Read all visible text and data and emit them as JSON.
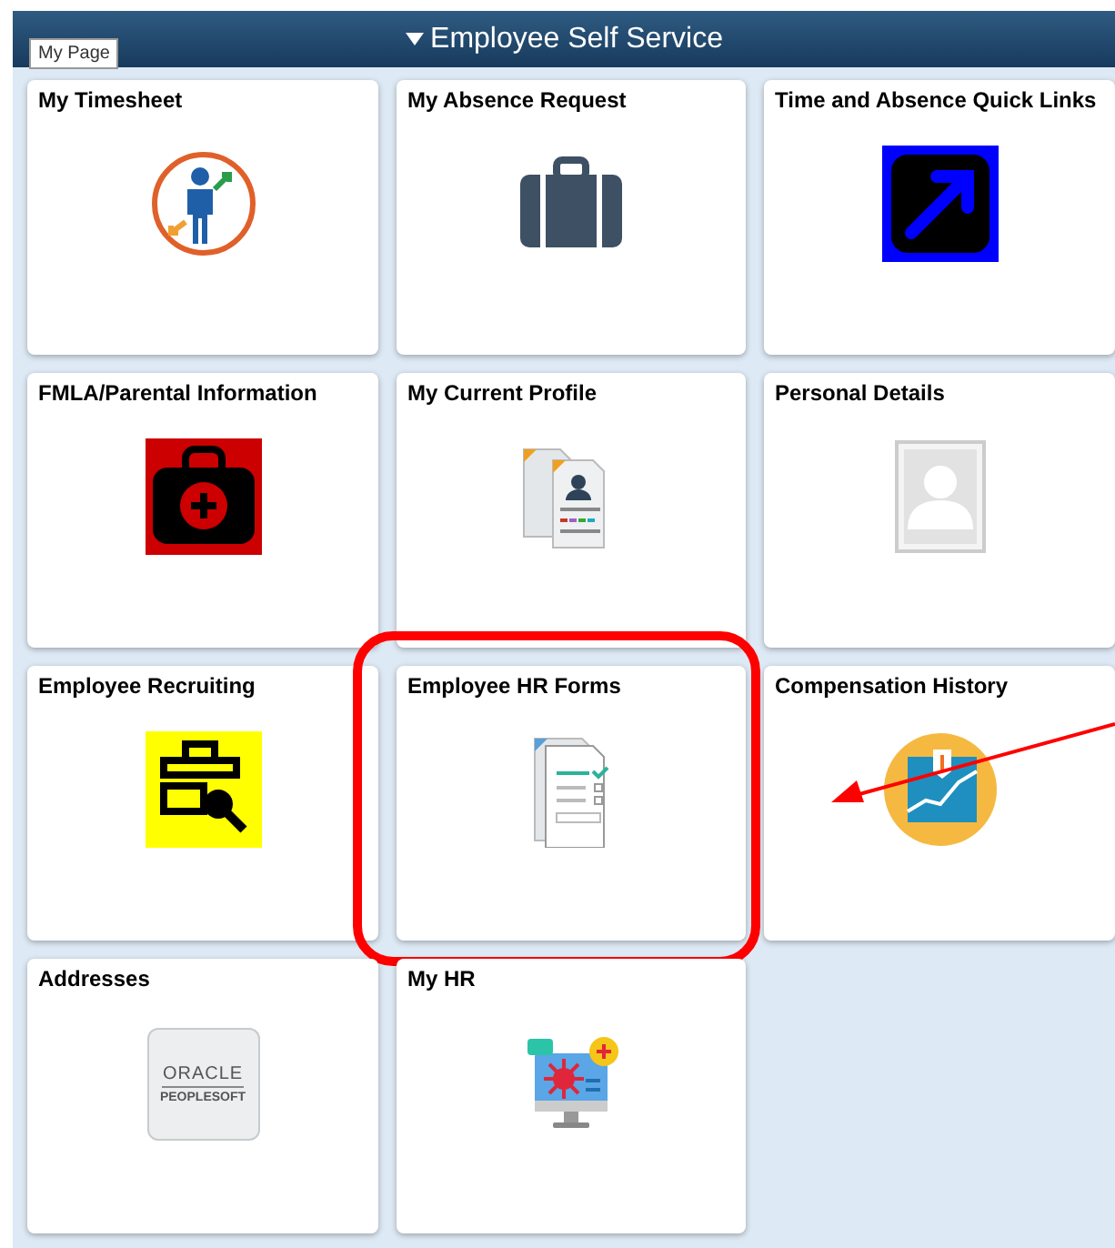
{
  "header": {
    "title": "Employee Self Service",
    "tooltip": "My Page"
  },
  "tiles": [
    {
      "title": "My Timesheet",
      "highlighted": false
    },
    {
      "title": "My Absence Request",
      "highlighted": false
    },
    {
      "title": "Time and Absence Quick Links",
      "highlighted": false
    },
    {
      "title": "FMLA/Parental Information",
      "highlighted": false
    },
    {
      "title": "My Current Profile",
      "highlighted": false
    },
    {
      "title": "Personal Details",
      "highlighted": false
    },
    {
      "title": "Employee Recruiting",
      "highlighted": false
    },
    {
      "title": "Employee HR Forms",
      "highlighted": true
    },
    {
      "title": "Compensation History",
      "highlighted": false
    },
    {
      "title": "Addresses",
      "highlighted": false,
      "logo_text": [
        "ORACLE",
        "PEOPLESOFT"
      ]
    },
    {
      "title": "My HR",
      "highlighted": false
    }
  ],
  "pointer_arrow": true
}
